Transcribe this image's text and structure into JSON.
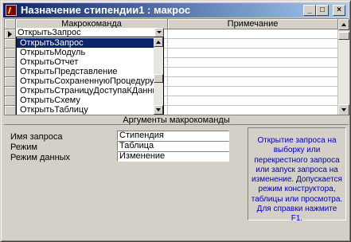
{
  "window": {
    "title": "Назначение стипендии1 : макрос",
    "buttons": {
      "minimize": "_",
      "maximize": "□",
      "close": "×"
    }
  },
  "grid": {
    "columns": [
      "Макрокоманда",
      "Примечание"
    ],
    "current_action": "ОткрытьЗапрос",
    "rows": 9
  },
  "dropdown": {
    "items": [
      "ОткрытьЗапрос",
      "ОткрытьМодуль",
      "ОткрытьОтчет",
      "ОткрытьПредставление",
      "ОткрытьСохраненнуюПроцедуру",
      "ОткрытьСтраницуДоступаКДанным",
      "ОткрытьСхему",
      "ОткрытьТаблицу"
    ],
    "selected_index": 0
  },
  "arguments": {
    "header": "Аргументы макрокоманды",
    "fields": [
      {
        "label": "Имя запроса",
        "value": "Стипендия"
      },
      {
        "label": "Режим",
        "value": "Таблица"
      },
      {
        "label": "Режим данных",
        "value": "Изменение"
      }
    ],
    "hint": "Открытие запроса на выборку или перекрестного запроса или запуск запроса на изменение. Допускается режим конструктора, таблицы или просмотра. Для справки нажмите F1."
  },
  "colors": {
    "title_start": "#0a246a",
    "title_end": "#a6caf0",
    "hint_text": "#0000c0",
    "selection": "#0a246a"
  }
}
